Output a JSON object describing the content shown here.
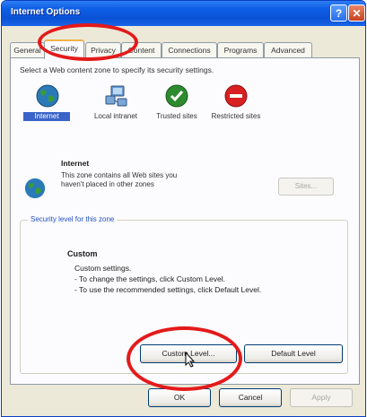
{
  "window": {
    "title": "Internet Options"
  },
  "tabs": [
    {
      "label": "General"
    },
    {
      "label": "Security"
    },
    {
      "label": "Privacy"
    },
    {
      "label": "Content"
    },
    {
      "label": "Connections"
    },
    {
      "label": "Programs"
    },
    {
      "label": "Advanced"
    }
  ],
  "active_tab": "Security",
  "instruction": "Select a Web content zone to specify its security settings.",
  "zones": [
    {
      "label": "Internet",
      "icon": "globe-icon",
      "selected": true
    },
    {
      "label": "Local intranet",
      "icon": "network-computer-icon",
      "selected": false
    },
    {
      "label": "Trusted sites",
      "icon": "checkmark-icon",
      "selected": false
    },
    {
      "label": "Restricted sites",
      "icon": "no-entry-icon",
      "selected": false
    }
  ],
  "zone_info": {
    "name": "Internet",
    "description": "This zone contains all Web sites you haven't placed in other zones",
    "sites_button": "Sites..."
  },
  "security_level": {
    "group_title": "Security level for this zone",
    "level": "Custom",
    "line1": "Custom settings.",
    "line2": "- To change the settings, click Custom Level.",
    "line3": "- To use the recommended settings, click Default Level."
  },
  "buttons": {
    "custom_level": "Custom Level...",
    "default_level": "Default Level",
    "ok": "OK",
    "cancel": "Cancel",
    "apply": "Apply"
  },
  "colors": {
    "highlight": "#e41a1a",
    "titlebar": "#0a52d6",
    "selected_zone": "#3b64c8"
  }
}
